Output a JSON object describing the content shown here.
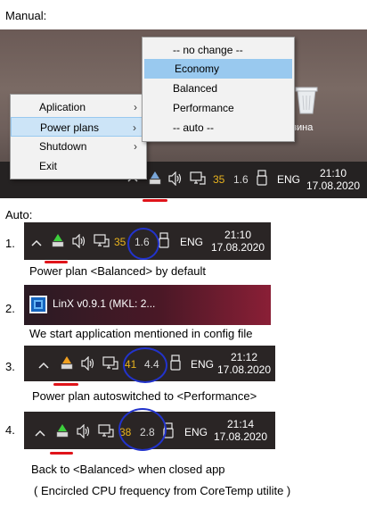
{
  "manual": {
    "header": "Manual:",
    "tray_menu": {
      "items": [
        {
          "label": "Aplication",
          "has_submenu": true,
          "selected": false
        },
        {
          "label": "Power plans",
          "has_submenu": true,
          "selected": true
        },
        {
          "label": "Shutdown",
          "has_submenu": true,
          "selected": false
        },
        {
          "label": "Exit",
          "has_submenu": false,
          "selected": false
        }
      ]
    },
    "submenu": {
      "items": [
        {
          "label": "-- no change --",
          "selected": false
        },
        {
          "label": "Economy",
          "selected": true
        },
        {
          "label": "Balanced",
          "selected": false
        },
        {
          "label": "Performance",
          "selected": false
        },
        {
          "label": "-- auto --",
          "selected": false
        }
      ]
    },
    "desktop_icon_label": "рзина",
    "taskbar": {
      "temp": "35",
      "freq": "1.6",
      "lang": "ENG",
      "time": "21:10",
      "date": "17.08.2020"
    }
  },
  "auto": {
    "header": "Auto:",
    "steps": [
      {
        "number": "1.",
        "taskbar": {
          "temp": "35",
          "freq": "1.6",
          "lang": "ENG",
          "time": "21:10",
          "date": "17.08.2020",
          "plan_color": "#3ccf3c"
        },
        "caption": "Power plan <Balanced> by default"
      },
      {
        "number": "2.",
        "app_title": "LinX v0.9.1 (MKL: 2...",
        "caption": "We start application mentioned in config file"
      },
      {
        "number": "3.",
        "taskbar": {
          "temp": "41",
          "freq": "4.4",
          "lang": "ENG",
          "time": "21:12",
          "date": "17.08.2020",
          "plan_color": "#f0a020"
        },
        "caption": "Power plan autoswitched to <Performance>"
      },
      {
        "number": "4.",
        "taskbar": {
          "temp": "38",
          "freq": "2.8",
          "lang": "ENG",
          "time": "21:14",
          "date": "17.08.2020",
          "plan_color": "#3ccf3c"
        },
        "caption": "Back to <Balanced> when closed app"
      }
    ],
    "footnote": "( Encircled CPU frequency from CoreTemp utilite )"
  },
  "colors": {
    "taskbar_bg": "#252222",
    "menu_bg": "#f2f2f2",
    "menu_highlight": "#cce4f7",
    "submenu_highlight": "#99c9ef",
    "temp_text": "#e8b31e",
    "annotation_red": "#e0141a",
    "annotation_blue": "#2233cc"
  },
  "icons": [
    "chevron-up-icon",
    "power-plan-icon",
    "speaker-icon",
    "network-icon",
    "usb-icon",
    "linx-app-icon",
    "recycle-bin-icon"
  ]
}
